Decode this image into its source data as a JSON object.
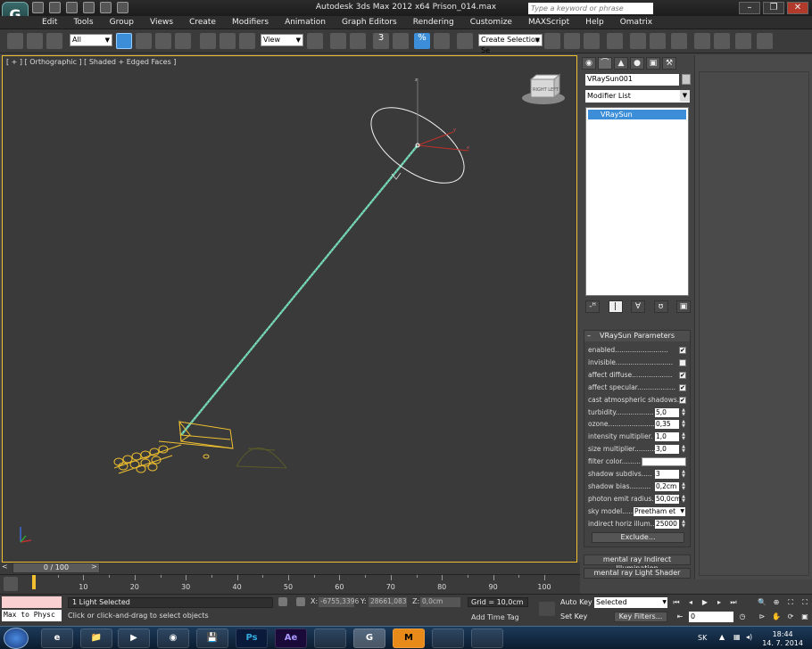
{
  "window": {
    "title": "Autodesk 3ds Max  2012 x64       Prison_014.max",
    "search_placeholder": "Type a keyword or phrase",
    "controls": [
      "–",
      "❐",
      "✕"
    ]
  },
  "menu": [
    "Edit",
    "Tools",
    "Group",
    "Views",
    "Create",
    "Modifiers",
    "Animation",
    "Graph Editors",
    "Rendering",
    "Customize",
    "MAXScript",
    "Help",
    "Omatrix"
  ],
  "toolbar": {
    "filter_value": "All",
    "ref_coord_value": "View",
    "selection_set_value": "Create Selection Se",
    "snap_label": "3",
    "percent_snap_label": "%"
  },
  "viewport": {
    "label": "[ + ] [ Orthographic ] [ Shaded + Edged Faces ]",
    "viewcube_label": "RIGHT LEFT",
    "axis_labels": {
      "z": "z",
      "x": "x",
      "y": "y"
    }
  },
  "command_panel": {
    "tabs": [
      "◉",
      "⌒",
      "▲",
      "●",
      "▣",
      "⚒"
    ],
    "object_name": "VRaySun001",
    "modifier_list_label": "Modifier List",
    "stack_items": [
      "VRaySun"
    ],
    "stack_buttons": [
      "-ᴴ",
      "|",
      "∀",
      "ʊ",
      "▣"
    ],
    "rollout_title": "VRaySun Parameters",
    "params": [
      {
        "label": "enabled.........................",
        "type": "check",
        "checked": true
      },
      {
        "label": "invisible...........................",
        "type": "check",
        "checked": false
      },
      {
        "label": "affect diffuse...................",
        "type": "check",
        "checked": true
      },
      {
        "label": "affect specular..................",
        "type": "check",
        "checked": true
      },
      {
        "label": "cast atmospheric shadows..",
        "type": "check",
        "checked": true
      },
      {
        "label": "turbidity..................",
        "type": "spin",
        "value": "5,0"
      },
      {
        "label": "ozone.......................",
        "type": "spin",
        "value": "0,35"
      },
      {
        "label": "intensity multiplier.",
        "type": "spin",
        "value": "1,0"
      },
      {
        "label": "size multiplier...........",
        "type": "spin",
        "value": "3,0"
      },
      {
        "label": "filter color.........",
        "type": "color",
        "value": "#ffffff"
      },
      {
        "label": "shadow subdivs.....",
        "type": "spin",
        "value": "3"
      },
      {
        "label": "shadow bias..........",
        "type": "spin",
        "value": "0,2cm"
      },
      {
        "label": "photon emit radius.",
        "type": "spin",
        "value": "50,0cm"
      },
      {
        "label": "sky model.........",
        "type": "dropdown",
        "value": "Preetham et"
      },
      {
        "label": "indirect horiz illum..",
        "type": "spin",
        "value": "25000"
      }
    ],
    "exclude_label": "Exclude...",
    "closed_rollouts": [
      "mental ray Indirect Illumination",
      "mental ray Light Shader"
    ]
  },
  "timeline": {
    "slider_label": "0 / 100",
    "arrow_left": "<",
    "arrow_right": ">",
    "ticks": [
      0,
      10,
      20,
      30,
      40,
      50,
      60,
      70,
      80,
      90,
      100
    ],
    "tick_labels": [
      "10",
      "20",
      "30",
      "40",
      "50",
      "60",
      "70",
      "80",
      "90",
      "100"
    ]
  },
  "status": {
    "maxscript_text": "Max to Physc",
    "selection": "1 Light Selected",
    "prompt": "Click or click-and-drag to select objects",
    "x_label": "X:",
    "x_value": "-6755,3396",
    "y_label": "Y:",
    "y_value": "28661,083",
    "z_label": "Z:",
    "z_value": "0,0cm",
    "grid": "Grid = 10,0cm",
    "add_time_tag": "Add Time Tag",
    "auto_key": "Auto Key",
    "set_key": "Set Key",
    "selected_value": "Selected",
    "key_filters": "Key Filters...",
    "frame_value": "0"
  },
  "taskbar": {
    "apps": [
      "e",
      "📁",
      "▶",
      "◉",
      "💾",
      "Ps",
      "Ae",
      "",
      "G",
      "M",
      "",
      ""
    ],
    "lang": "SK",
    "time": "18:44",
    "date": "14. 7. 2014"
  },
  "colors": {
    "selection_yellow": "#f0c030",
    "light_wire": "#7fe0c0",
    "stack_highlight": "#3d8ed8"
  }
}
